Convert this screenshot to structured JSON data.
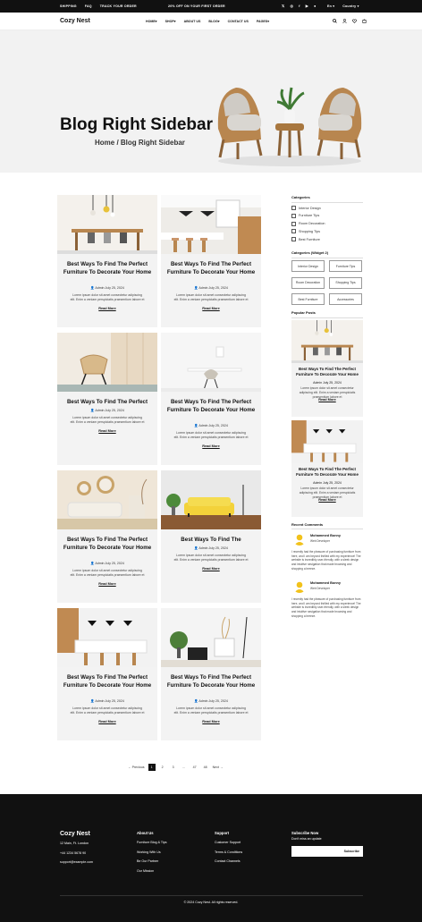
{
  "topbar": {
    "links": [
      "SHIPPING",
      "FAQ",
      "TRACK YOUR ORDER"
    ],
    "promo": "20% OFF ON YOUR FIRST ORDER",
    "lang": "En",
    "country": "Country"
  },
  "nav": {
    "logo": "Cozy Nest",
    "menu": [
      "HOME",
      "SHOP",
      "ABOUT US",
      "BLOG",
      "CONTACT US",
      "PAGES"
    ]
  },
  "hero": {
    "title": "Blog Right Sidebar",
    "breadcrumb": "Home / Blog Right Sidebar"
  },
  "posts": [
    {
      "title": "Best Ways To Find The Perfect Furniture To Decorate Your Home",
      "meta": "Admin   July 25, 2024",
      "excerpt": "Lorem ipsum dolor sit amet consectetur adipiscing elit. Enim a veniam perspiciatis praesentium labore et",
      "more": "Read More"
    },
    {
      "title": "Best Ways To Find The Perfect Furniture To Decorate Your Home",
      "meta": "Admin   July 25, 2024",
      "excerpt": "Lorem ipsum dolor sit amet consectetur adipiscing elit. Enim a veniam perspiciatis praesentium labore et",
      "more": "Read More"
    },
    {
      "title": "Best Ways To Find The Perfect",
      "meta": "Admin   July 25, 2024",
      "excerpt": "Lorem ipsum dolor sit amet consectetur adipiscing elit. Enim a veniam perspiciatis praesentium labore et",
      "more": "Read More"
    },
    {
      "title": "Best Ways To Find The Perfect Furniture To Decorate Your Home",
      "meta": "Admin   July 25, 2024",
      "excerpt": "Lorem ipsum dolor sit amet consectetur adipiscing elit. Enim a veniam perspiciatis praesentium labore et",
      "more": "Read More"
    },
    {
      "title": "Best Ways To Find The Perfect Furniture To Decorate Your Home",
      "meta": "Admin   July 25, 2024",
      "excerpt": "Lorem ipsum dolor sit amet consectetur adipiscing elit. Enim a veniam perspiciatis praesentium labore et",
      "more": "Read More"
    },
    {
      "title": "Best Ways To Find The",
      "meta": "Admin   July 25, 2024",
      "excerpt": "Lorem ipsum dolor sit amet consectetur adipiscing elit. Enim a veniam perspiciatis praesentium labore et",
      "more": "Read More"
    },
    {
      "title": "Best Ways To Find The Perfect Furniture To Decorate Your Home",
      "meta": "Admin   July 25, 2024",
      "excerpt": "Lorem ipsum dolor sit amet consectetur adipiscing elit. Enim a veniam perspiciatis praesentium labore et",
      "more": "Read More"
    },
    {
      "title": "Best Ways To Find The Perfect Furniture To Decorate Your Home",
      "meta": "Admin   July 25, 2024",
      "excerpt": "Lorem ipsum dolor sit amet consectetur adipiscing elit. Enim a veniam perspiciatis praesentium labore et",
      "more": "Read More"
    }
  ],
  "sidebar": {
    "categories_title": "Categories",
    "categories": [
      "Interior Design",
      "Furniture Tips",
      "Room Decoration",
      "Shopping Tips",
      "Best Furniture"
    ],
    "widget2_title": "Categories (Widget 2)",
    "tags": [
      "Interior Design",
      "Furniture Tips",
      "Room Decoration",
      "Shopping Tips",
      "Best Furniture",
      "Accessories"
    ],
    "popular_title": "Popular Posts",
    "popular": [
      {
        "title": "Best Ways To Find The Perfect Furniture To Decorate Your Home",
        "meta": "Admin   July 25, 2024",
        "excerpt": "Lorem ipsum dolor sit amet consectetur adipiscing elit. Enim a veniam perspiciatis praesentium labore et",
        "more": "Read More"
      },
      {
        "title": "Best Ways To Find The Perfect Furniture To Decorate Your Home",
        "meta": "Admin   July 25, 2024",
        "excerpt": "Lorem ipsum dolor sit amet consectetur adipiscing elit. Enim a veniam perspiciatis praesentium labore et",
        "more": "Read More"
      }
    ],
    "comments_title": "Recent Comments",
    "comments": [
      {
        "name": "Mohammed Bonny",
        "role": "Web Developer",
        "text": "I recently had the pleasure of purchasing furniture from here, and I am beyond thrilled with my experience! The website is incredibly user-friendly, with a sleek design and intuitive navigation that made browsing and shopping a breeze."
      },
      {
        "name": "Mohammed Bonny",
        "role": "Web Developer",
        "text": "I recently had the pleasure of purchasing furniture from here, and I am beyond thrilled with my experience! The website is incredibly user-friendly, with a sleek design and intuitive navigation that made browsing and shopping a breeze."
      }
    ]
  },
  "pagination": {
    "prev": "← Previous",
    "pages": [
      "1",
      "2",
      "3",
      "...",
      "47",
      "48"
    ],
    "next": "Next →"
  },
  "footer": {
    "logo": "Cozy Nest",
    "address": "12 Main, Ft. London",
    "phone": "+44 1234 5678 90",
    "email": "support@example.com",
    "about_title": "About Us",
    "about": [
      "Furniture Blog & Tips",
      "Working With Us",
      "Be Our Partner",
      "Our Mission"
    ],
    "support_title": "Support",
    "support": [
      "Customer Support",
      "Terms & Conditions",
      "Contact Channels"
    ],
    "subscribe_title": "Subscribe Now",
    "subscribe_sub": "Don't miss an update",
    "subscribe_btn": "Subscribe",
    "copyright": "© 2024 Cozy Nest. All rights reserved."
  },
  "colors": {
    "dark": "#111111",
    "light_bg": "#f3f3f3",
    "avatar": "#f2c21b",
    "sofa": "#f3d23a",
    "wood": "#b8864f"
  }
}
